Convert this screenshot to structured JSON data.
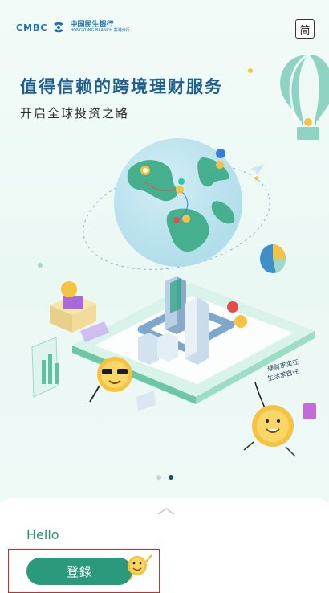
{
  "header": {
    "brand_latin": "CMBC",
    "brand_cn": "中国民生银行",
    "brand_sub": "HONGKONG BRANCH 香港分行",
    "language_toggle": "简"
  },
  "banner": {
    "headline": "值得信赖的跨境理财服务",
    "subheadline": "开启全球投资之路",
    "coin_sign": "理财求实在 生活求自在",
    "page_dots": {
      "count": 2,
      "active_index": 1
    }
  },
  "sheet": {
    "greeting": "Hello",
    "login_label": "登錄"
  },
  "colors": {
    "brand_blue": "#1e6fb3",
    "headline_blue": "#1f5f8f",
    "accent_green": "#2b9a7c",
    "focus_red": "#d9262b"
  },
  "icons": [
    "cmbc-logo-icon",
    "globe-illustration",
    "hot-air-balloon-icon",
    "coin-mascot-icon",
    "pie-chart-icon",
    "chevron-up-icon"
  ]
}
